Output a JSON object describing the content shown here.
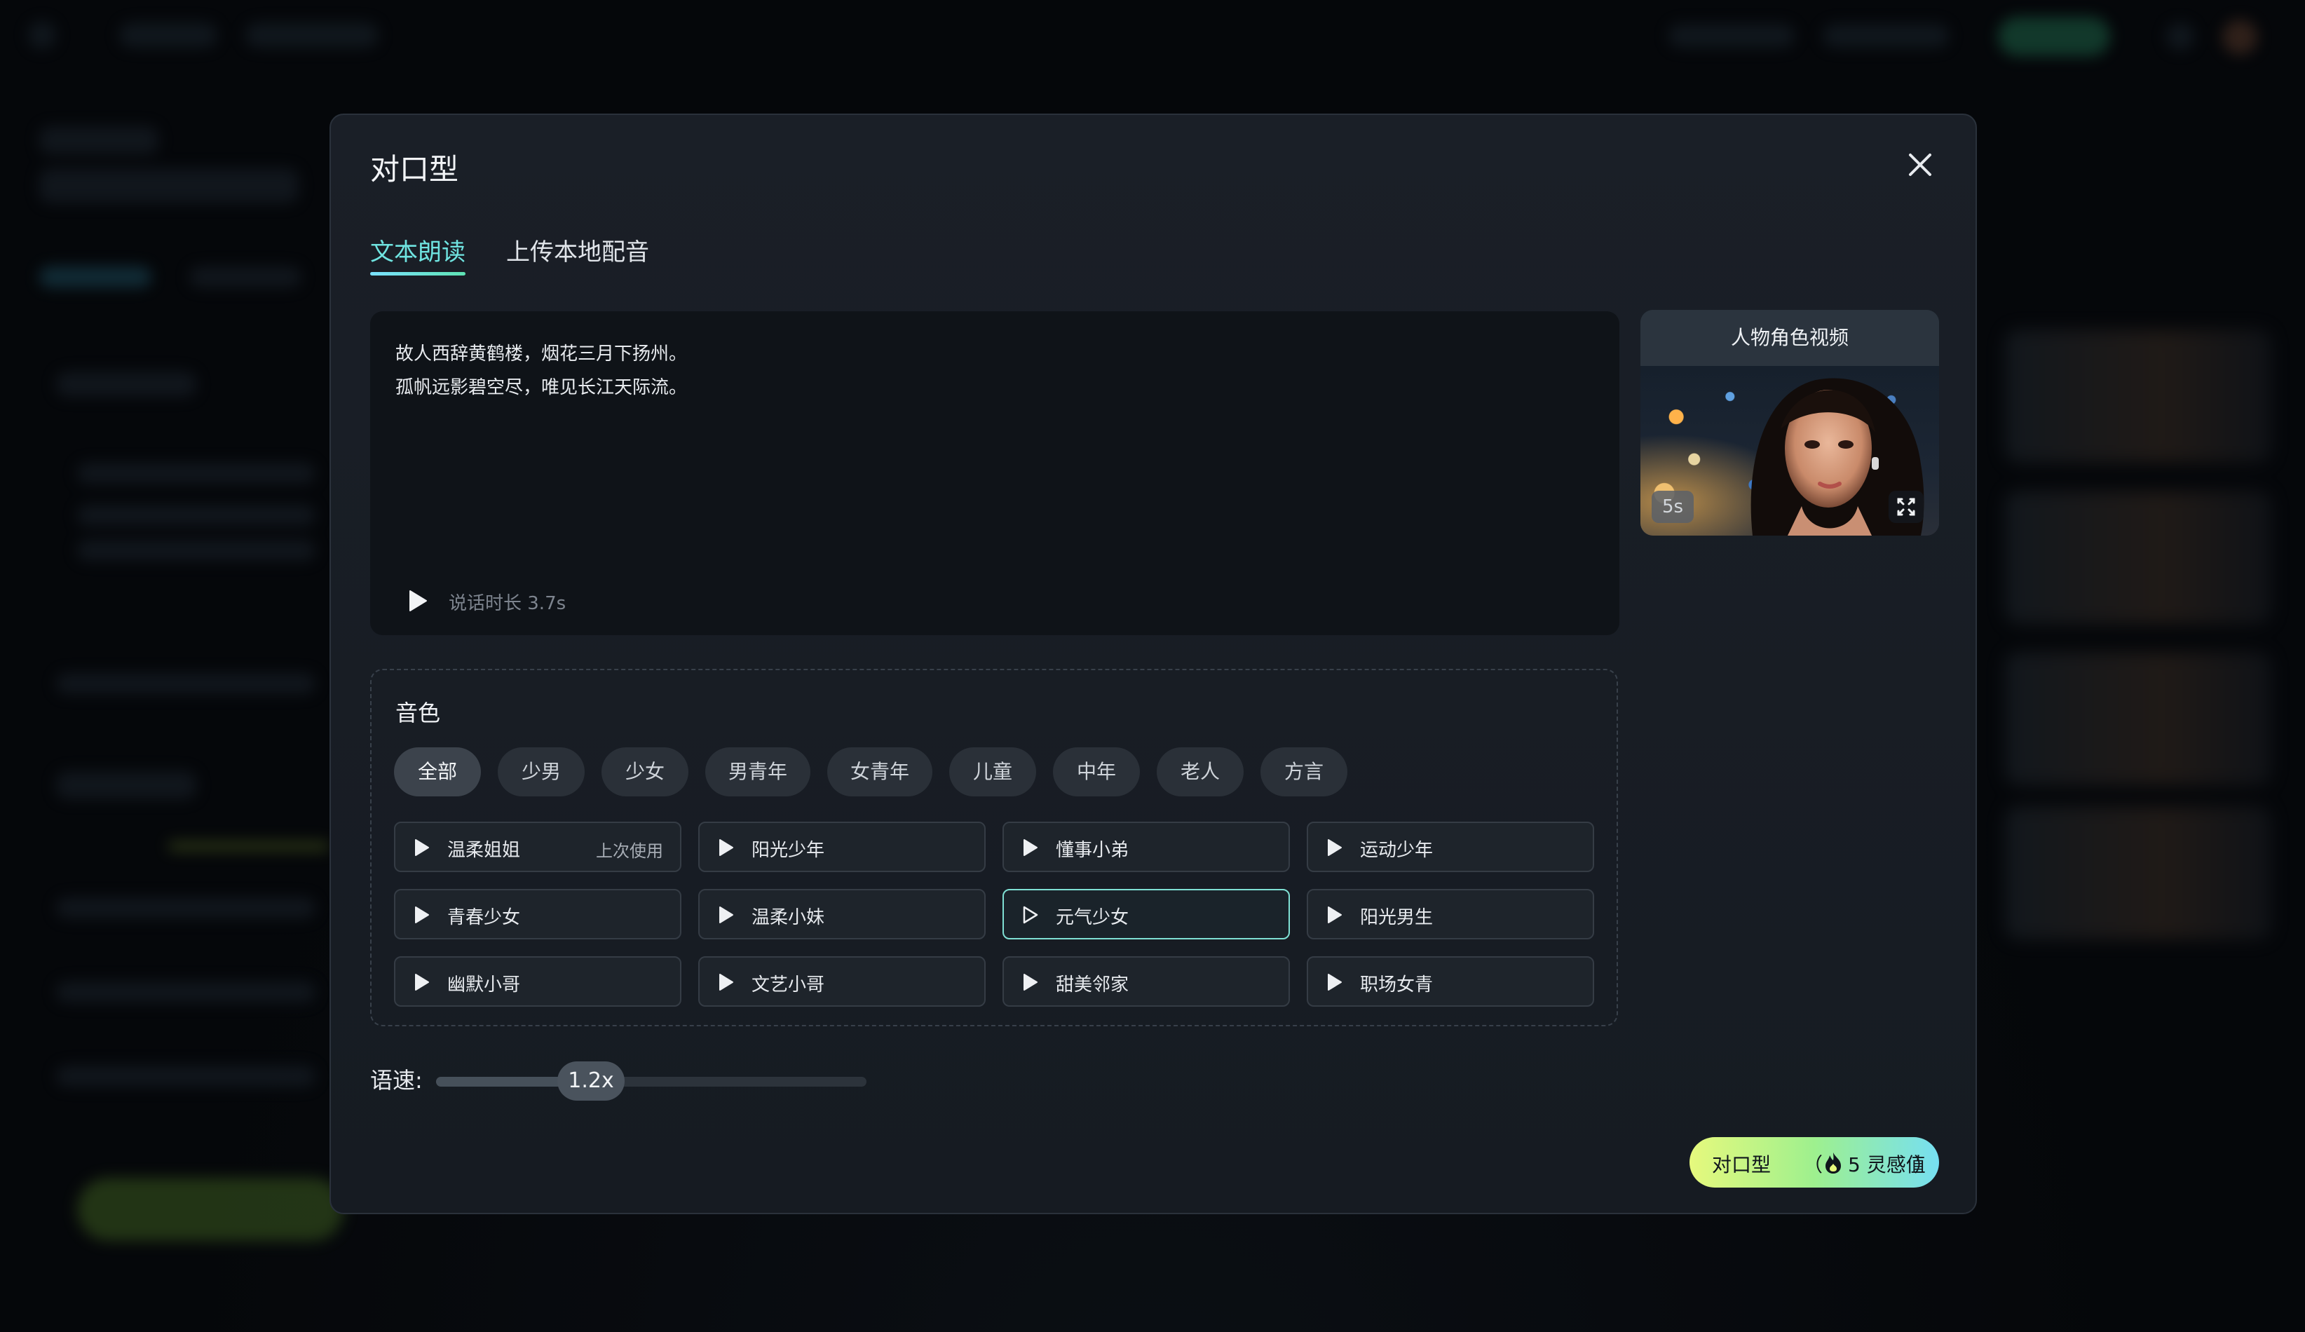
{
  "modal": {
    "title": "对口型",
    "tabs": [
      {
        "label": "文本朗读",
        "active": true
      },
      {
        "label": "上传本地配音",
        "active": false
      }
    ]
  },
  "text_panel": {
    "lines": [
      "故人西辞黄鹤楼，烟花三月下扬州。",
      "孤帆远影碧空尽，唯见长江天际流。"
    ],
    "duration_text": "说话时长 3.7s"
  },
  "character_card": {
    "title": "人物角色视频",
    "duration_badge": "5s"
  },
  "voice": {
    "title": "音色",
    "categories": [
      "全部",
      "少男",
      "少女",
      "男青年",
      "女青年",
      "儿童",
      "中年",
      "老人",
      "方言"
    ],
    "active_category": "全部",
    "voices": [
      {
        "name": "温柔姐姐",
        "tag": "上次使用"
      },
      {
        "name": "阳光少年",
        "tag": ""
      },
      {
        "name": "懂事小弟",
        "tag": ""
      },
      {
        "name": "运动少年",
        "tag": ""
      },
      {
        "name": "青春少女",
        "tag": ""
      },
      {
        "name": "温柔小妹",
        "tag": ""
      },
      {
        "name": "元气少女",
        "tag": ""
      },
      {
        "name": "阳光男生",
        "tag": ""
      },
      {
        "name": "幽默小哥",
        "tag": ""
      },
      {
        "name": "文艺小哥",
        "tag": ""
      },
      {
        "name": "甜美邻家",
        "tag": ""
      },
      {
        "name": "职场女青",
        "tag": ""
      }
    ],
    "selected_voice": "元气少女"
  },
  "speed": {
    "label": "语速:",
    "value_text": "1.2x",
    "fraction": 0.36
  },
  "submit": {
    "label": "对口型",
    "paren_open": "（",
    "amount": "5 灵感值",
    "paren_close": "）"
  },
  "colors": {
    "accent_tab": "#6fe3e0",
    "selected_border": "#7fe0d4",
    "submit_gradient": [
      "#e6f97d",
      "#9ef08e",
      "#76dff2"
    ]
  },
  "icons": {
    "close": "close-icon",
    "play": "play-icon",
    "expand": "expand-icon",
    "flame": "flame-icon"
  }
}
